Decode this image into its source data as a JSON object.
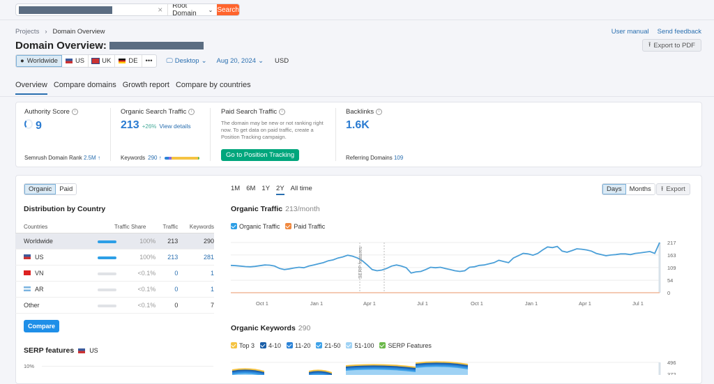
{
  "search": {
    "query_redacted": true,
    "type": "Root Domain",
    "button": "Search",
    "clear_icon": "×"
  },
  "breadcrumb": {
    "items": [
      "Projects",
      "Domain Overview"
    ],
    "separator": "›"
  },
  "header": {
    "title": "Domain Overview:",
    "links": [
      "User manual",
      "Send feedback"
    ],
    "export_pdf": "Export to PDF"
  },
  "databases": {
    "items": [
      {
        "label": "Worldwide",
        "active": true
      },
      {
        "label": "US"
      },
      {
        "label": "UK"
      },
      {
        "label": "DE"
      },
      {
        "label": "•••"
      }
    ],
    "device": "Desktop",
    "date": "Aug 20, 2024",
    "currency": "USD"
  },
  "tabs": [
    "Overview",
    "Compare domains",
    "Growth report",
    "Compare by countries"
  ],
  "metrics": {
    "authority": {
      "label": "Authority Score",
      "value": "9",
      "footer_label": "Semrush Domain Rank",
      "footer_value": "2.5M ↑"
    },
    "organic": {
      "label": "Organic Search Traffic",
      "value": "213",
      "change": "+26%",
      "link": "View details",
      "footer_label": "Keywords",
      "footer_value": "290 ↑"
    },
    "paid": {
      "label": "Paid Search Traffic",
      "text": "The domain may be new or not ranking right now. To get data on paid traffic, create a Position Tracking campaign.",
      "button": "Go to Position Tracking"
    },
    "backlinks": {
      "label": "Backlinks",
      "value": "1.6K",
      "footer_label": "Referring Domains",
      "footer_value": "109"
    }
  },
  "distribution": {
    "toggle": [
      "Organic",
      "Paid"
    ],
    "title": "Distribution by Country",
    "columns": [
      "Countries",
      "Traffic Share",
      "Traffic",
      "Keywords"
    ],
    "rows": [
      {
        "country": "Worldwide",
        "share": "100%",
        "share_fraction": 1.0,
        "traffic": "213",
        "keywords": "290"
      },
      {
        "country": "US",
        "share": "100%",
        "share_fraction": 1.0,
        "traffic": "213",
        "keywords": "281"
      },
      {
        "country": "VN",
        "share": "<0.1%",
        "share_fraction": 0,
        "traffic": "0",
        "keywords": "1"
      },
      {
        "country": "AR",
        "share": "<0.1%",
        "share_fraction": 0,
        "traffic": "0",
        "keywords": "1"
      },
      {
        "country": "Other",
        "share": "<0.1%",
        "share_fraction": 0,
        "traffic": "0",
        "keywords": "7"
      }
    ],
    "compare_button": "Compare"
  },
  "serp": {
    "title": "SERP features",
    "db": "US",
    "axis_top": "10%"
  },
  "periods": {
    "items": [
      "1M",
      "6M",
      "1Y",
      "2Y",
      "All time"
    ],
    "active": "2Y"
  },
  "granularity": {
    "items": [
      "Days",
      "Months"
    ],
    "active": "Days",
    "export": "Export"
  },
  "chart_data": [
    {
      "type": "line",
      "title": "Organic Traffic",
      "subtitle": "213/month",
      "legend": [
        {
          "name": "Organic Traffic",
          "color": "#2d9fe6"
        },
        {
          "name": "Paid Traffic",
          "color": "#f0883e"
        }
      ],
      "x_ticks": [
        "Oct 1",
        "Jan 1",
        "Apr 1",
        "Jul 1",
        "Oct 1",
        "Jan 1",
        "Apr 1",
        "Jul 1"
      ],
      "y_ticks": [
        "0",
        "54",
        "109",
        "163",
        "217"
      ],
      "ylim": [
        0,
        217
      ],
      "annotation": "SERP features",
      "series": [
        {
          "name": "Organic Traffic",
          "values": [
            118,
            117,
            115,
            113,
            112,
            114,
            117,
            120,
            119,
            115,
            105,
            100,
            103,
            107,
            110,
            108,
            115,
            120,
            125,
            130,
            138,
            142,
            150,
            155,
            162,
            158,
            150,
            138,
            120,
            100,
            95,
            98,
            105,
            115,
            120,
            115,
            108,
            85,
            90,
            92,
            100,
            110,
            108,
            110,
            105,
            100,
            95,
            92,
            95,
            110,
            112,
            118,
            120,
            125,
            130,
            140,
            135,
            130,
            150,
            160,
            170,
            168,
            162,
            170,
            185,
            198,
            195,
            200,
            180,
            175,
            182,
            190,
            188,
            185,
            180,
            170,
            165,
            160,
            163,
            165,
            168,
            168,
            165,
            170,
            172,
            175,
            178,
            170,
            217
          ]
        },
        {
          "name": "Paid Traffic",
          "values": [
            0,
            0
          ]
        }
      ]
    },
    {
      "type": "area",
      "title": "Organic Keywords",
      "subtitle": "290",
      "legend": [
        {
          "name": "Top 3",
          "color": "#f5c342"
        },
        {
          "name": "4-10",
          "color": "#1b5fa8"
        },
        {
          "name": "11-20",
          "color": "#2a82d7"
        },
        {
          "name": "21-50",
          "color": "#3ea2e8"
        },
        {
          "name": "51-100",
          "color": "#9fd2f4"
        },
        {
          "name": "SERP Features",
          "color": "#6bb94a"
        }
      ],
      "y_ticks": [
        "496",
        "372"
      ]
    }
  ]
}
